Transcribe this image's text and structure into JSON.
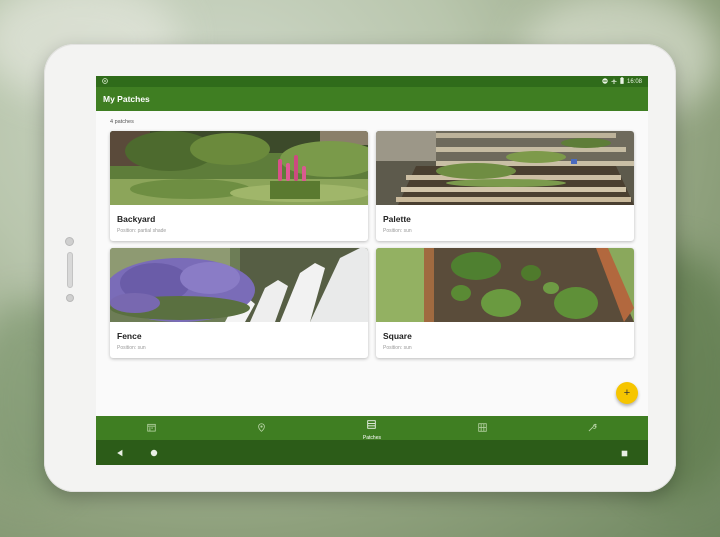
{
  "status_bar": {
    "time": "16:08"
  },
  "toolbar": {
    "title": "My Patches"
  },
  "content": {
    "count_label": "4 patches",
    "patches": [
      {
        "name": "Backyard",
        "position": "Position: partial shade"
      },
      {
        "name": "Palette",
        "position": "Position: sun"
      },
      {
        "name": "Fence",
        "position": "Position: sun"
      },
      {
        "name": "Square",
        "position": "Position: sun"
      }
    ]
  },
  "fab": {
    "label": "+"
  },
  "bottom_nav": {
    "items": [
      {
        "icon": "calendar-icon",
        "label": ""
      },
      {
        "icon": "location-pin-icon",
        "label": ""
      },
      {
        "icon": "patches-icon",
        "label": "Patches",
        "active": true
      },
      {
        "icon": "planner-icon",
        "label": ""
      },
      {
        "icon": "tools-icon",
        "label": ""
      }
    ]
  },
  "colors": {
    "primary": "#3f7e22",
    "primary_dark": "#2f6b1a",
    "accent": "#f6c500"
  }
}
